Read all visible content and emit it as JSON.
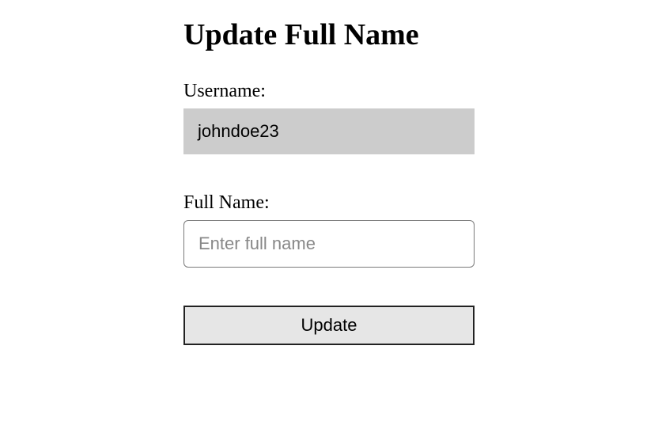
{
  "title": "Update Full Name",
  "form": {
    "username": {
      "label": "Username:",
      "value": "johndoe23"
    },
    "fullname": {
      "label": "Full Name:",
      "placeholder": "Enter full name",
      "value": ""
    },
    "submit_label": "Update"
  }
}
